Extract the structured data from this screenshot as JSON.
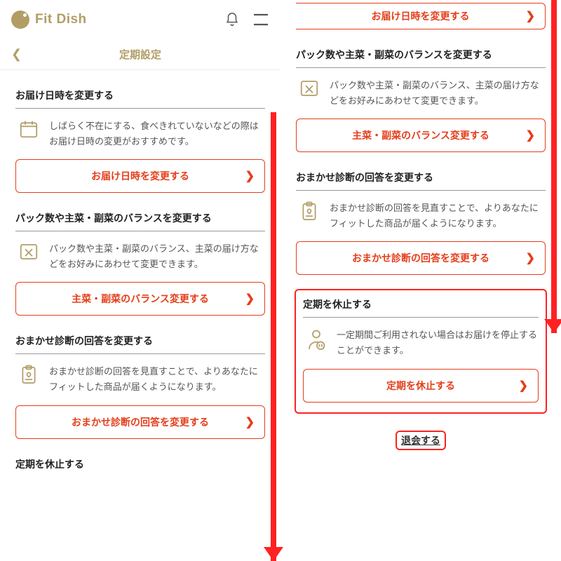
{
  "brand": "Fit Dish",
  "subheader": {
    "title": "定期設定"
  },
  "sections": [
    {
      "title": "お届け日時を変更する",
      "desc": "しばらく不在にする、食べきれていないなどの際はお届け日時の変更がおすすめです。",
      "cta": "お届け日時を変更する"
    },
    {
      "title": "パック数や主菜・副菜のバランスを変更する",
      "desc": "パック数や主菜・副菜のバランス、主菜の届け方などをお好みにあわせて変更できます。",
      "cta": "主菜・副菜のバランス変更する"
    },
    {
      "title": "おまかせ診断の回答を変更する",
      "desc": "おまかせ診断の回答を見直すことで、よりあなたにフィットした商品が届くようになります。",
      "cta": "おまかせ診断の回答を変更する"
    },
    {
      "title": "定期を休止する",
      "desc": "一定期間ご利用されない場合はお届けを停止することができます。",
      "cta": "定期を休止する"
    }
  ],
  "withdraw": "退会する"
}
